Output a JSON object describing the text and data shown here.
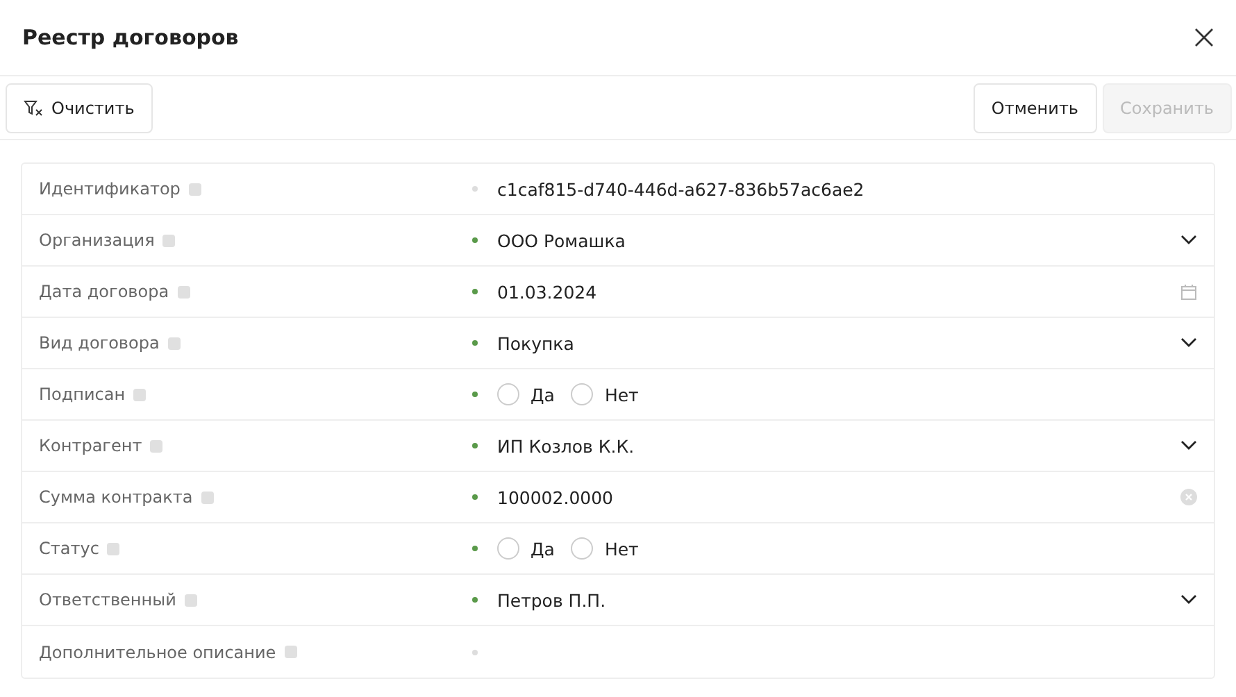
{
  "window": {
    "title": "Реестр договоров"
  },
  "toolbar": {
    "clear": "Очистить",
    "cancel": "Отменить",
    "save": {
      "label": "Сохранить",
      "disabled": true
    }
  },
  "fields": [
    {
      "label": "Идентификатор",
      "kind": "text",
      "editable": false,
      "value": "c1caf815-d740-446d-a627-836b57ac6ae2"
    },
    {
      "label": "Организация",
      "kind": "select",
      "editable": true,
      "value": "ООО Ромашка"
    },
    {
      "label": "Дата договора",
      "kind": "date",
      "editable": true,
      "value": "01.03.2024"
    },
    {
      "label": "Вид договора",
      "kind": "select",
      "editable": true,
      "value": "Покупка"
    },
    {
      "label": "Подписан",
      "kind": "radio",
      "editable": true,
      "options": [
        {
          "label": "Да",
          "selected": false
        },
        {
          "label": "Нет",
          "selected": false
        }
      ]
    },
    {
      "label": "Контрагент",
      "kind": "select",
      "editable": true,
      "value": "ИП Козлов К.К."
    },
    {
      "label": "Сумма контракта",
      "kind": "clearable",
      "editable": true,
      "value": "100002.0000"
    },
    {
      "label": "Статус",
      "kind": "radio",
      "editable": true,
      "options": [
        {
          "label": "Да",
          "selected": false
        },
        {
          "label": "Нет",
          "selected": false
        }
      ]
    },
    {
      "label": "Ответственный",
      "kind": "select",
      "editable": true,
      "value": "Петров П.П."
    },
    {
      "label": "Дополнительное описание",
      "kind": "text",
      "editable": false
    }
  ]
}
